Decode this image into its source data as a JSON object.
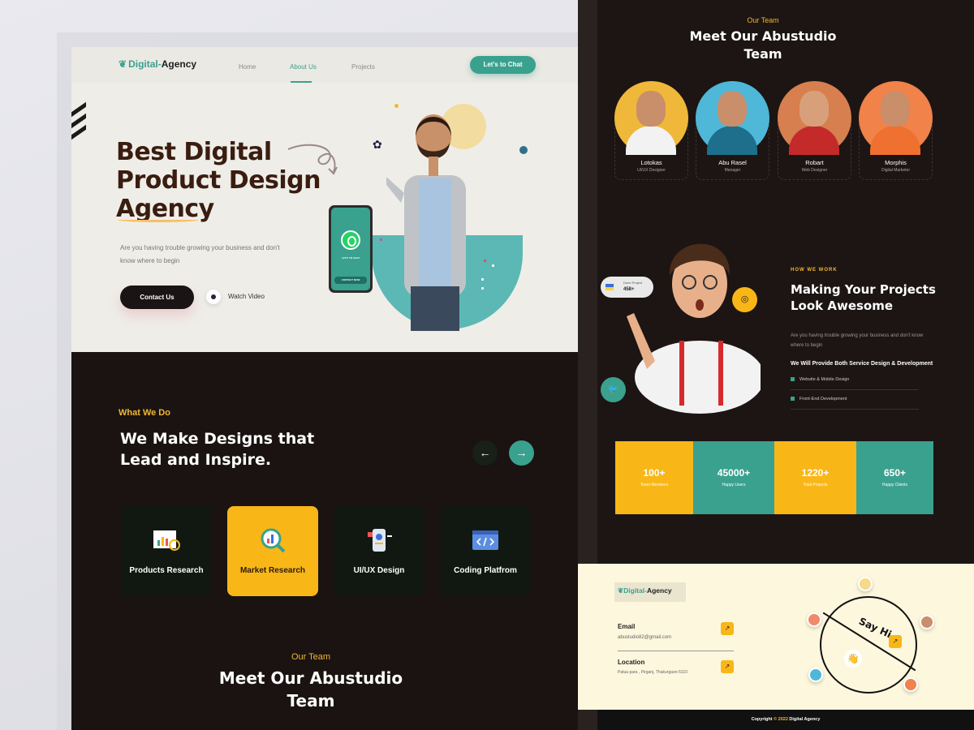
{
  "colors": {
    "accent_teal": "#3aa18e",
    "accent_yellow": "#f9b617",
    "dark_bg": "#1a1311",
    "hero_bg": "#efede8"
  },
  "brand": {
    "name_prefix": "Digital-",
    "name_suffix": "Agency"
  },
  "nav": {
    "items": [
      "Home",
      "About Us",
      "Projects"
    ],
    "active": "About Us",
    "cta": "Let's to Chat"
  },
  "hero": {
    "title_lines": [
      "Best Digital",
      "Product Design",
      "Agency"
    ],
    "subtitle": "Are you having trouble growing your business and don't know where to begin",
    "contact_button": "Contact Us",
    "watch_video": "Watch Video",
    "phone_text": "LET'S TO CHAT",
    "phone_button": "CONTACT NOW"
  },
  "services": {
    "eyebrow": "What We Do",
    "title_lines": [
      "We Make Designs that",
      "Lead and Inspire."
    ],
    "prev_icon": "arrow-left-icon",
    "next_icon": "arrow-right-icon",
    "cards": [
      {
        "label": "Products Research",
        "icon": "chart-board-icon",
        "selected": false
      },
      {
        "label": "Market Research",
        "icon": "magnifier-chart-icon",
        "selected": true
      },
      {
        "label": "UI/UX Design",
        "icon": "phone-design-icon",
        "selected": false
      },
      {
        "label": "Coding Platfrom",
        "icon": "code-window-icon",
        "selected": false
      }
    ]
  },
  "team_left": {
    "eyebrow": "Our Team",
    "title_lines": [
      "Meet Our Abustudio",
      "Team"
    ]
  },
  "team_right": {
    "eyebrow": "Our Team",
    "title_lines": [
      "Meet Our Abustudio",
      "Team"
    ],
    "members": [
      {
        "name": "Lotokas",
        "role": "UI/UX Designer",
        "bg": "#f0b83a"
      },
      {
        "name": "Abu Rasel",
        "role": "Manager",
        "bg": "#4fb8d8"
      },
      {
        "name": "Robart",
        "role": "Web Designer",
        "bg": "#d77f4f"
      },
      {
        "name": "Morphis",
        "role": "Digital Marketer",
        "bg": "#f0824a"
      }
    ]
  },
  "how": {
    "eyebrow": "HOW WE WORK",
    "title_lines": [
      "Making Your Projects",
      "Look Awesome"
    ],
    "subtitle": "Are you having trouble growing your business and don't know where to begin",
    "provide": "We Will Provide Both Service Design & Development",
    "checks": [
      "Website & Mobile Design",
      "Front-End Development"
    ],
    "done_label": "Done Project",
    "done_value": "458+"
  },
  "stats": [
    {
      "value": "100+",
      "label": "Team Members",
      "color": "#f9b617"
    },
    {
      "value": "45000+",
      "label": "Happy Users",
      "color": "#3aa18e"
    },
    {
      "value": "1220+",
      "label": "Total Projects",
      "color": "#f9b617"
    },
    {
      "value": "650+",
      "label": "Happy Clients",
      "color": "#3aa18e"
    }
  ],
  "contact": {
    "email_label": "Email",
    "email_value": "abustudio82@gmail.com",
    "location_label": "Location",
    "location_value": "Patua para , Pirganj, Thakurgaon-5110",
    "say_hi": "Say Hi"
  },
  "footer": {
    "prefix": "Copyright ",
    "year": "© 2022",
    "suffix": " Digital Agency"
  }
}
